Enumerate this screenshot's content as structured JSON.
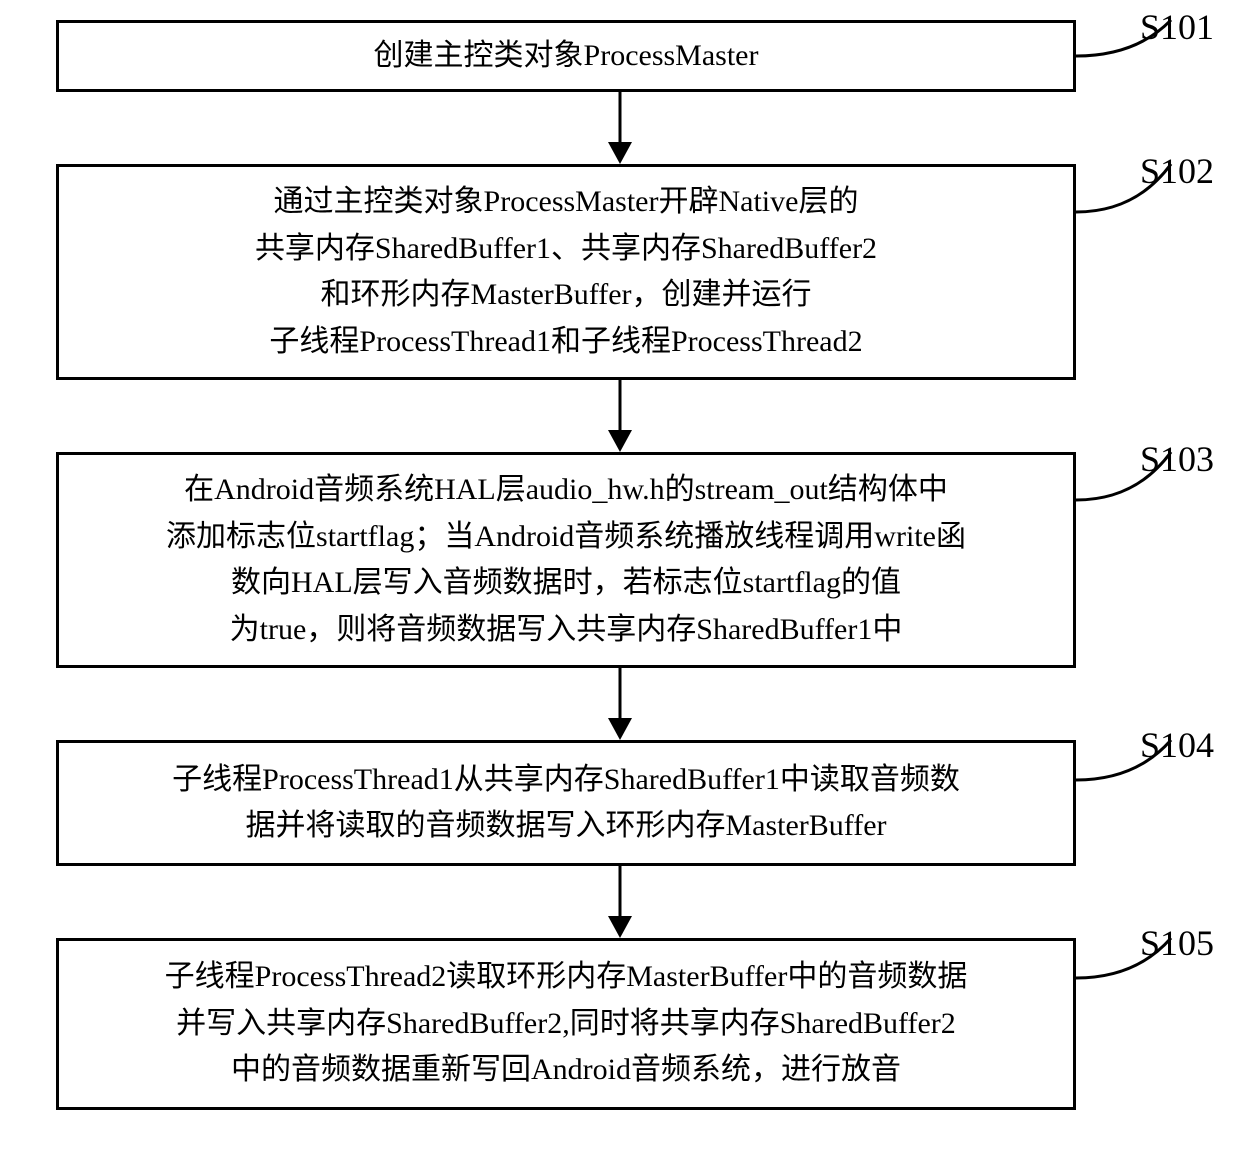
{
  "steps": [
    {
      "id": "s101",
      "label": "S101",
      "text": "创建主控类对象ProcessMaster"
    },
    {
      "id": "s102",
      "label": "S102",
      "text": "通过主控类对象ProcessMaster开辟Native层的\n共享内存SharedBuffer1、共享内存SharedBuffer2\n和环形内存MasterBuffer，创建并运行\n子线程ProcessThread1和子线程ProcessThread2"
    },
    {
      "id": "s103",
      "label": "S103",
      "text": "在Android音频系统HAL层audio_hw.h的stream_out结构体中\n添加标志位startflag；当Android音频系统播放线程调用write函\n数向HAL层写入音频数据时，若标志位startflag的值\n为true，则将音频数据写入共享内存SharedBuffer1中"
    },
    {
      "id": "s104",
      "label": "S104",
      "text": "子线程ProcessThread1从共享内存SharedBuffer1中读取音频数\n据并将读取的音频数据写入环形内存MasterBuffer"
    },
    {
      "id": "s105",
      "label": "S105",
      "text": "子线程ProcessThread2读取环形内存MasterBuffer中的音频数据\n并写入共享内存SharedBuffer2,同时将共享内存SharedBuffer2\n中的音频数据重新写回Android音频系统，进行放音"
    }
  ]
}
